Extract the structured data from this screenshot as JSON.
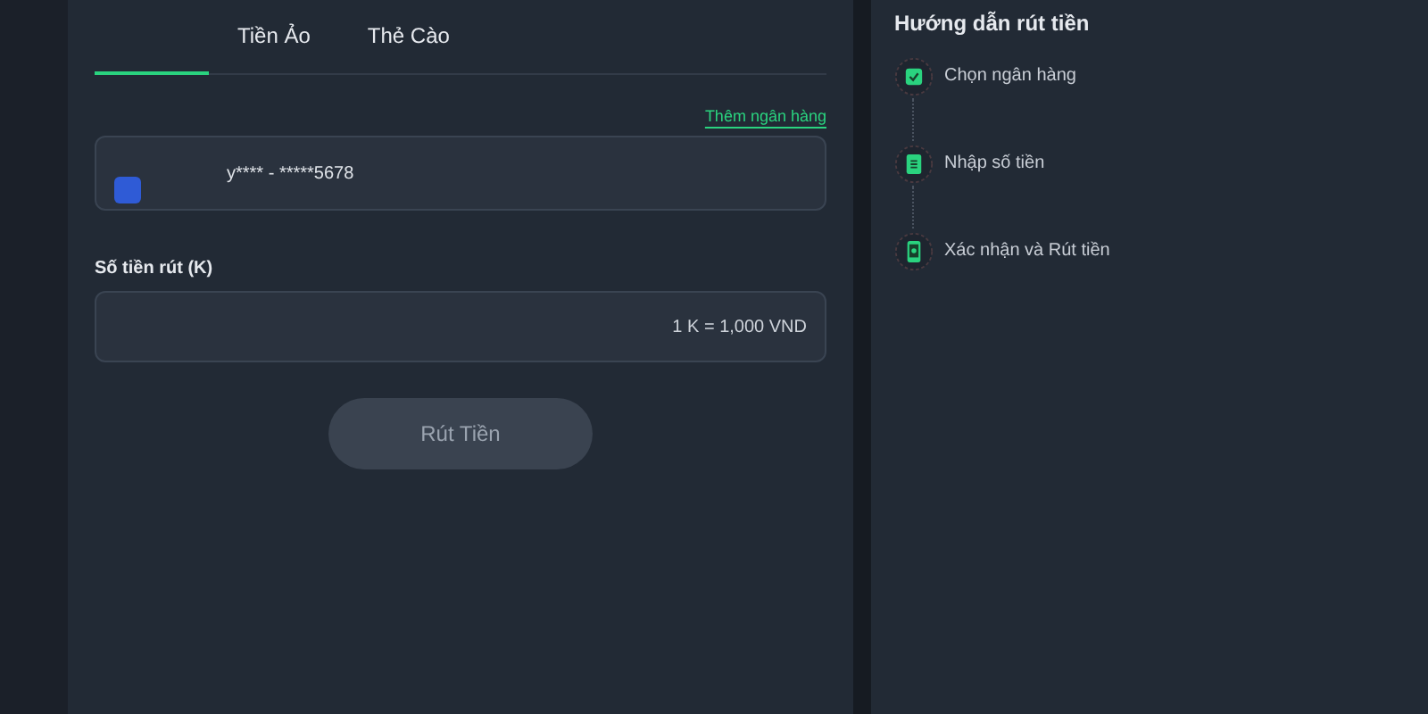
{
  "tabs": [
    {
      "selected": true
    },
    {
      "label": "Tiền Ảo",
      "selected": false
    },
    {
      "label": "Thẻ Cào",
      "selected": false
    }
  ],
  "add_bank_link": "Thêm ngân hàng",
  "bank_field": {
    "value": "y**** - *****5678"
  },
  "amount": {
    "label": "Số tiền rút (K)",
    "placeholder": "1 K = 1,000 VND"
  },
  "submit": {
    "label": "Rút Tiền",
    "disabled": true
  },
  "guide": {
    "title": "Hướng dẫn rút tiền",
    "steps": [
      {
        "kind": "bank",
        "label": "Chọn ngân hàng"
      },
      {
        "kind": "amount",
        "label": "Nhập số tiền"
      },
      {
        "kind": "confirm",
        "label": "Xác nhận và Rút tiền"
      }
    ]
  }
}
